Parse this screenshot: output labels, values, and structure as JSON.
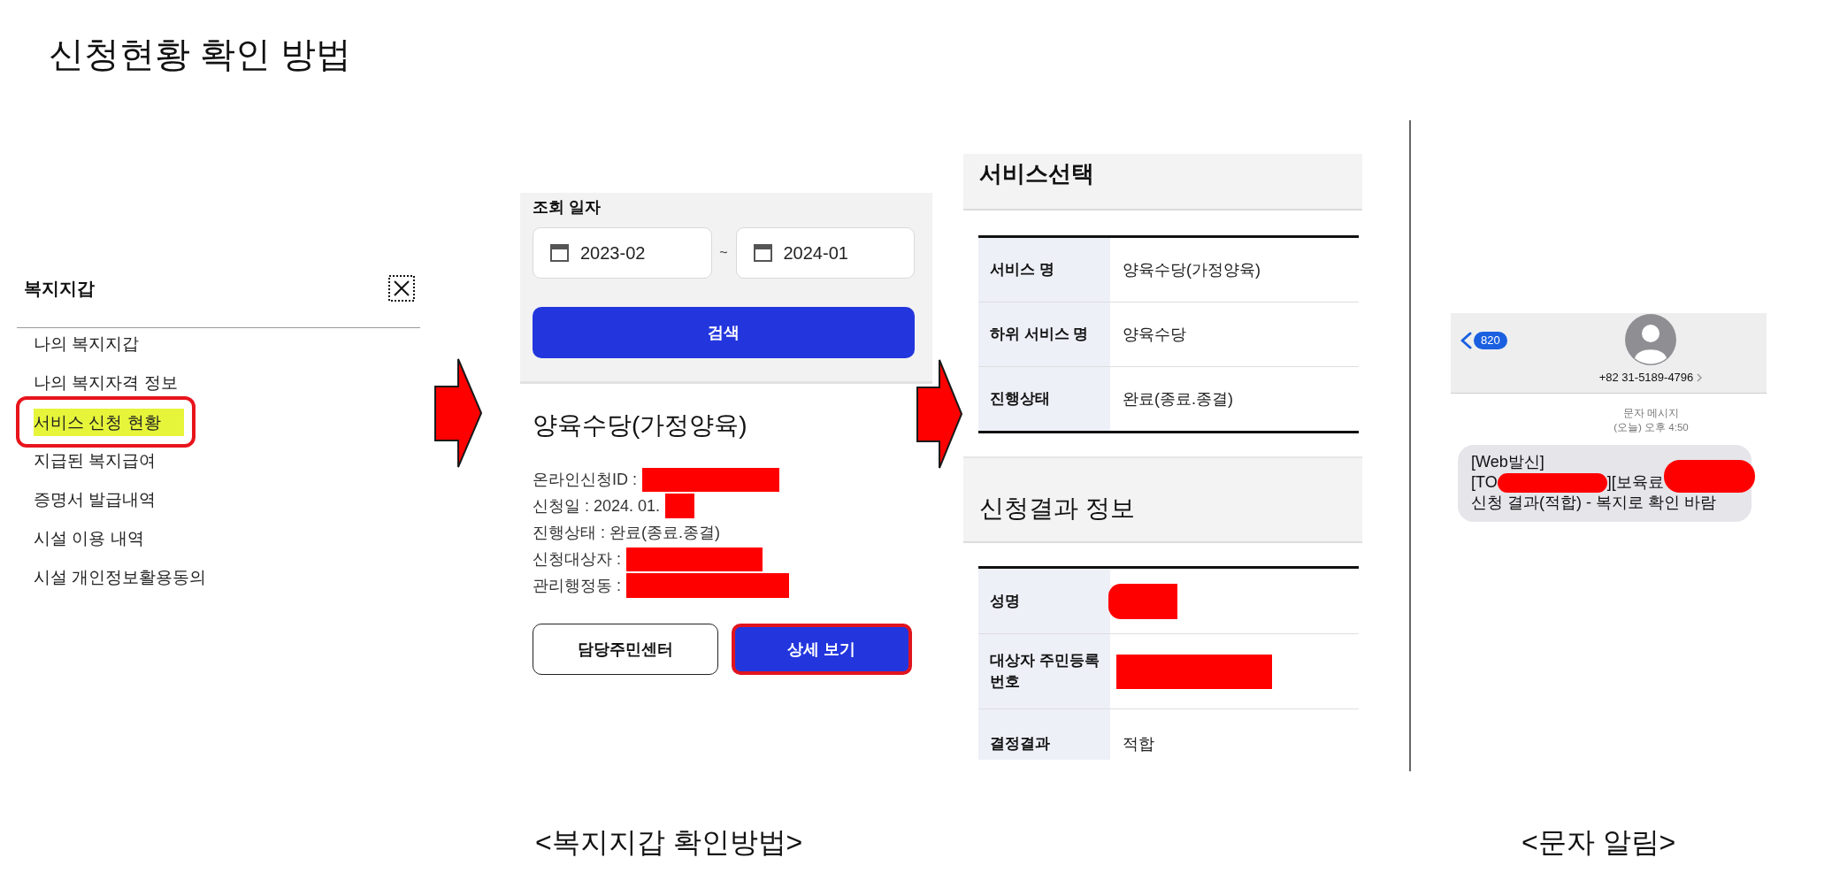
{
  "title": "신청현황 확인 방법",
  "wallet_menu": {
    "title": "복지지갑",
    "items": [
      {
        "label": "나의 복지지갑",
        "selected": false
      },
      {
        "label": "나의 복지자격 정보",
        "selected": false
      },
      {
        "label": "서비스 신청 현황",
        "selected": true
      },
      {
        "label": "지급된 복지급여",
        "selected": false
      },
      {
        "label": "증명서 발급내역",
        "selected": false
      },
      {
        "label": "시설 이용 내역",
        "selected": false
      },
      {
        "label": "시설 개인정보활용동의",
        "selected": false
      }
    ]
  },
  "search_screen": {
    "filter": {
      "label": "조회 일자",
      "start": "2023-02",
      "separator": "~",
      "end": "2024-01",
      "button": "검색"
    },
    "result": {
      "title": "양육수당(가정양육)",
      "lines": [
        {
          "kind": "redacted",
          "text": "온라인신청ID :"
        },
        {
          "kind": "redacted",
          "text": "신청일 : 2024. 01."
        },
        {
          "kind": "plain",
          "text": "진행상태 : 완료(종료.종결)"
        },
        {
          "kind": "redacted",
          "text": "신청대상자 :"
        },
        {
          "kind": "redacted",
          "text": "관리행정동 :"
        }
      ],
      "buttons": [
        {
          "kind": "outline",
          "label": "담당주민센터",
          "highlighted": false
        },
        {
          "kind": "primary",
          "label": "상세 보기",
          "highlighted": true
        }
      ]
    }
  },
  "detail_screen": {
    "sections": [
      {
        "title": "서비스선택",
        "rows": [
          {
            "label": "서비스 명",
            "kind": "text",
            "value": "양육수당(가정양육)"
          },
          {
            "label": "하위 서비스 명",
            "kind": "text",
            "value": "양육수당"
          },
          {
            "label": "진행상태",
            "kind": "text",
            "value": "완료(종료.종결)"
          }
        ]
      },
      {
        "title": "신청결과 정보",
        "rows": [
          {
            "label": "성명",
            "kind": "redacted"
          },
          {
            "label": "대상자 주민등록 번호",
            "kind": "redacted"
          },
          {
            "label": "결정결과",
            "kind": "text",
            "value": "적합"
          }
        ]
      }
    ]
  },
  "sms_screen": {
    "badge": "820",
    "sender": "+82 31-5189-4796",
    "message_type": "문자 메시지",
    "time": "(오늘) 오후 4:50",
    "lines": [
      [
        {
          "kind": "text",
          "text": "[Web발신]"
        }
      ],
      [
        {
          "kind": "text",
          "text": "[TO"
        },
        {
          "kind": "redaction"
        },
        {
          "kind": "text",
          "text": "][보육료"
        },
        {
          "kind": "redaction"
        }
      ],
      [
        {
          "kind": "text",
          "text": "신청 결과(적합) - 복지로 확인 바람"
        }
      ]
    ]
  },
  "captions": [
    "<복지지갑 확인방법>",
    "<문자 알림>"
  ]
}
